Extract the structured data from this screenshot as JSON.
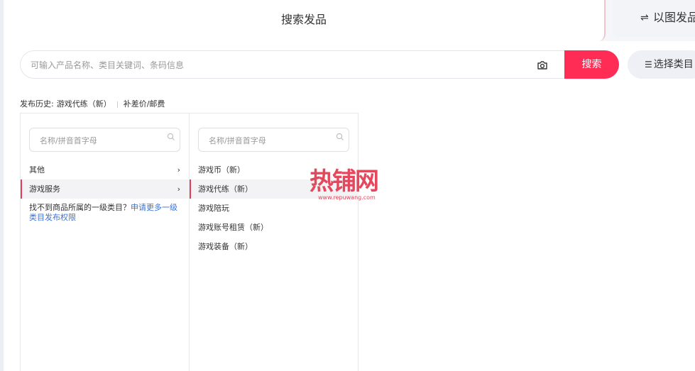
{
  "tabs": {
    "active_label": "搜索发品",
    "inactive_label": "以图发品",
    "inactive_icon": "⇌"
  },
  "search": {
    "placeholder": "可输入产品名称、类目关键词、条码信息",
    "button_label": "搜索",
    "category_button_label": "选择类目",
    "category_icon": "☰"
  },
  "history": {
    "label": "发布历史:",
    "items": [
      "游戏代练（新）",
      "补差价/邮费"
    ]
  },
  "col1": {
    "placeholder": "名称/拼音首字母",
    "items": [
      {
        "label": "其他",
        "active": false
      },
      {
        "label": "游戏服务",
        "active": true
      }
    ],
    "hint_text": "找不到商品所属的一级类目？",
    "hint_link": "申请更多一级类目发布权限"
  },
  "col2": {
    "placeholder": "名称/拼音首字母",
    "items": [
      {
        "label": "游戏币（新）",
        "active": false
      },
      {
        "label": "游戏代练（新）",
        "active": true
      },
      {
        "label": "游戏陪玩",
        "active": false
      },
      {
        "label": "游戏账号租赁（新）",
        "active": false
      },
      {
        "label": "游戏装备（新）",
        "active": false
      }
    ]
  },
  "watermark": {
    "text": "热铺网",
    "url": "www.repuwang.com"
  },
  "colors": {
    "accent": "#ff2d55",
    "active_border": "#e93a5a",
    "link": "#3a72d8"
  }
}
